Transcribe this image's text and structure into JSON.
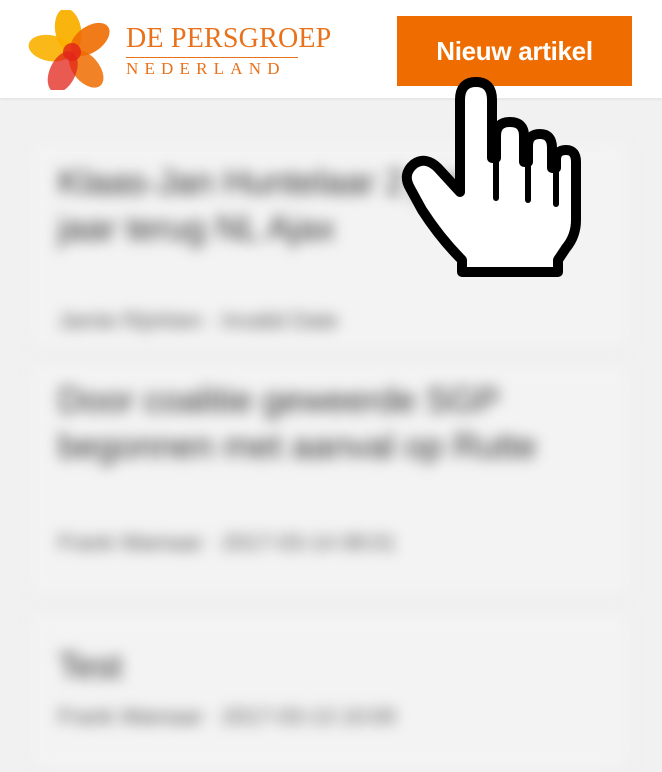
{
  "header": {
    "logo": {
      "line1": "DE PERSGROEP",
      "line2": "NEDERLAND",
      "colors": {
        "yellow": "#f9b000",
        "orange": "#ef6c00",
        "red": "#e2231a"
      }
    },
    "new_article_label": "Nieuw artikel",
    "accent_color": "#ef6c00"
  },
  "articles": [
    {
      "title": "Klaas-Jan Huntelaar 2 jaar... 6,5 jaar terug NL Ajax",
      "meta": "Jamie Rijnhien · Invalid Date"
    },
    {
      "title": "Door coalitie geweerde SGP begonnen met aanval op Rutte",
      "meta": "Frank Wamaar · 2017-03-14 08:01"
    },
    {
      "title": "Test",
      "meta": "Frank Wamaar · 2017-03-13 10:00"
    }
  ],
  "cursor": {
    "icon": "hand-pointer-icon"
  }
}
